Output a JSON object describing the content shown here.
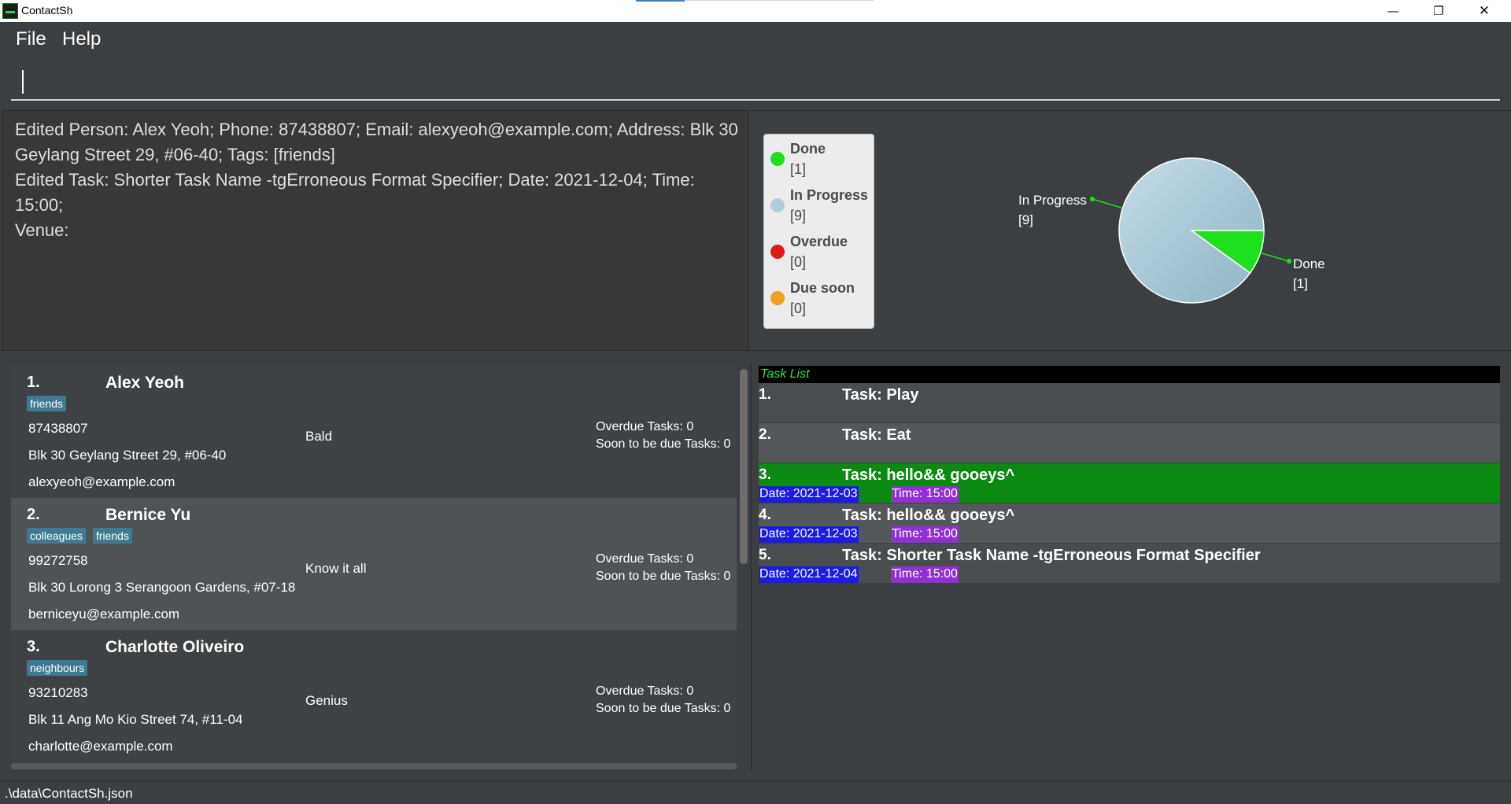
{
  "window": {
    "title": "ContactSh",
    "minimize_glyph": "—",
    "maximize_glyph": "❐",
    "close_glyph": "✕"
  },
  "menu": {
    "file": "File",
    "help": "Help"
  },
  "command": {
    "value": ""
  },
  "result": {
    "lines": [
      "Edited Person: Alex Yeoh; Phone: 87438807; Email: alexyeoh@example.com; Address: Blk 30",
      "Geylang Street 29, #06-40; Tags: [friends]",
      "Edited Task: Shorter Task Name -tgErroneous Format Specifier; Date: 2021-12-04; Time: 15:00;",
      "Venue:"
    ]
  },
  "stats": {
    "legend": [
      {
        "label": "Done",
        "count": "[1]",
        "color": "#1fe01f"
      },
      {
        "label": "In Progress",
        "count": "[9]",
        "color": "#aecedc"
      },
      {
        "label": "Overdue",
        "count": "[0]",
        "color": "#e01a1a"
      },
      {
        "label": "Due soon",
        "count": "[0]",
        "color": "#f0a020"
      }
    ],
    "chart_data": {
      "type": "pie",
      "title": "",
      "series": [
        {
          "name": "In Progress",
          "value": 9,
          "label": "In Progress",
          "count_label": "[9]",
          "color": "#aecedc"
        },
        {
          "name": "Done",
          "value": 1,
          "label": "Done",
          "count_label": "[1]",
          "color": "#1fe01f"
        }
      ]
    }
  },
  "persons": [
    {
      "index": "1.",
      "name": "Alex Yeoh",
      "tags": [
        "friends"
      ],
      "phone": "87438807",
      "address": "Blk 30 Geylang Street 29, #06-40",
      "email": "alexyeoh@example.com",
      "remark": "Bald",
      "overdue": "Overdue Tasks: 0",
      "soon_due": "Soon to be due Tasks: 0",
      "highlighted": false
    },
    {
      "index": "2.",
      "name": "Bernice Yu",
      "tags": [
        "colleagues",
        "friends"
      ],
      "phone": "99272758",
      "address": "Blk 30 Lorong 3 Serangoon Gardens, #07-18",
      "email": "berniceyu@example.com",
      "remark": "Know it all",
      "overdue": "Overdue Tasks: 0",
      "soon_due": "Soon to be due Tasks: 0",
      "highlighted": true
    },
    {
      "index": "3.",
      "name": "Charlotte Oliveiro",
      "tags": [
        "neighbours"
      ],
      "phone": "93210283",
      "address": "Blk 11 Ang Mo Kio Street 74, #11-04",
      "email": "charlotte@example.com",
      "remark": "Genius",
      "overdue": "Overdue Tasks: 0",
      "soon_due": "Soon to be due Tasks: 0",
      "highlighted": false
    }
  ],
  "tasks": {
    "header": "Task List",
    "items": [
      {
        "index": "1.",
        "name": "Task: Play",
        "date": "",
        "time": "",
        "bg": "#4a4d4f"
      },
      {
        "index": "2.",
        "name": "Task: Eat",
        "date": "",
        "time": "",
        "bg": "#54585a"
      },
      {
        "index": "3.",
        "name": "Task: hello&& gooeys^",
        "date": "Date: 2021-12-03",
        "time": "Time: 15:00",
        "bg": "#0a8a10"
      },
      {
        "index": "4.",
        "name": "Task: hello&& gooeys^",
        "date": "Date: 2021-12-03",
        "time": "Time: 15:00",
        "bg": "#54585a"
      },
      {
        "index": "5.",
        "name": "Task: Shorter Task Name -tgErroneous Format Specifier",
        "date": "Date: 2021-12-04",
        "time": "Time: 15:00",
        "bg": "#4a4d4f"
      }
    ]
  },
  "status": {
    "path": ".\\data\\ContactSh.json"
  },
  "colors": {
    "background": "#3c3f41",
    "person_highlight": "#4e5355",
    "person_normal": "#3f4244",
    "tag": "#3e7b91",
    "date_badge": "#1c1ce0",
    "time_badge": "#9030d0",
    "task_header_text": "#2fe047"
  }
}
